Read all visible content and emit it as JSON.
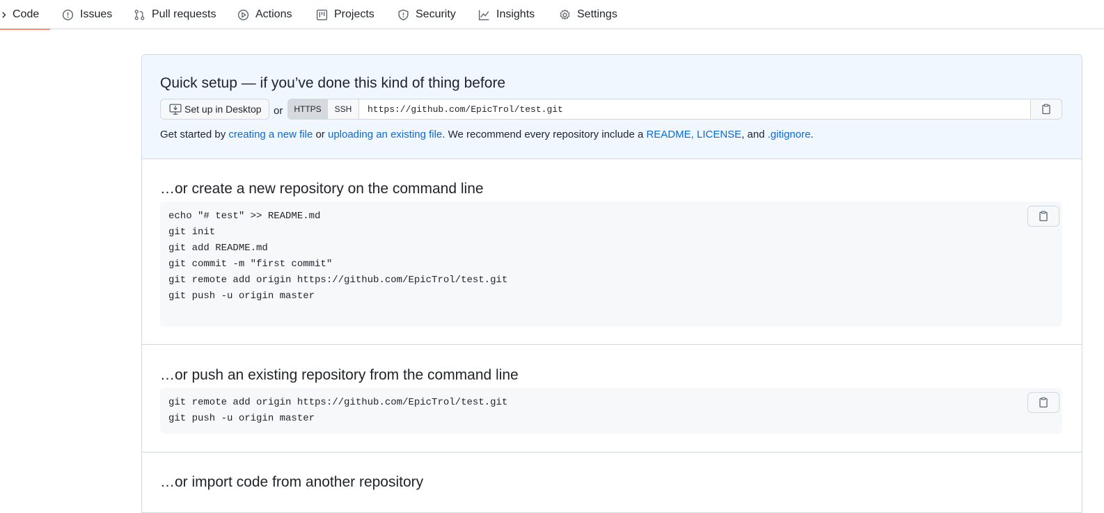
{
  "nav": {
    "tabs": [
      {
        "label": "Code",
        "icon": "code-icon"
      },
      {
        "label": "Issues",
        "icon": "issue-icon"
      },
      {
        "label": "Pull requests",
        "icon": "pull-request-icon"
      },
      {
        "label": "Actions",
        "icon": "play-icon"
      },
      {
        "label": "Projects",
        "icon": "project-icon"
      },
      {
        "label": "Security",
        "icon": "shield-icon"
      },
      {
        "label": "Insights",
        "icon": "graph-icon"
      },
      {
        "label": "Settings",
        "icon": "gear-icon"
      }
    ],
    "selected": "Code",
    "accent": "#fd8c73"
  },
  "quick_setup": {
    "title": "Quick setup — if you’ve done this kind of thing before",
    "desktop_button": "Set up in Desktop",
    "or_label": "or",
    "protocols": [
      "HTTPS",
      "SSH"
    ],
    "selected_protocol": "HTTPS",
    "clone_url": "https://github.com/EpicTrol/test.git",
    "hint": {
      "prefix": "Get started by ",
      "link_new_file": "creating a new file",
      "or_word": " or ",
      "link_upload": "uploading an existing file",
      "middle": ". We recommend every repository include a ",
      "link_readme": "README",
      "comma": ", ",
      "link_license": "LICENSE",
      "and_word": ", and ",
      "link_gitignore": ".gitignore",
      "suffix": "."
    },
    "background": "#f0f7fe"
  },
  "create_section": {
    "title": "…or create a new repository on the command line",
    "lines": [
      "echo \"# test\" >> README.md",
      "git init",
      "git add README.md",
      "git commit -m \"first commit\"",
      "git remote add origin https://github.com/EpicTrol/test.git",
      "git push -u origin master"
    ]
  },
  "push_section": {
    "title": "…or push an existing repository from the command line",
    "lines": [
      "git remote add origin https://github.com/EpicTrol/test.git",
      "git push -u origin master"
    ]
  },
  "import_section": {
    "title": "…or import code from another repository"
  },
  "colors": {
    "link": "#0969da",
    "border": "#d0d7de",
    "code_bg": "#f6f8fa"
  }
}
